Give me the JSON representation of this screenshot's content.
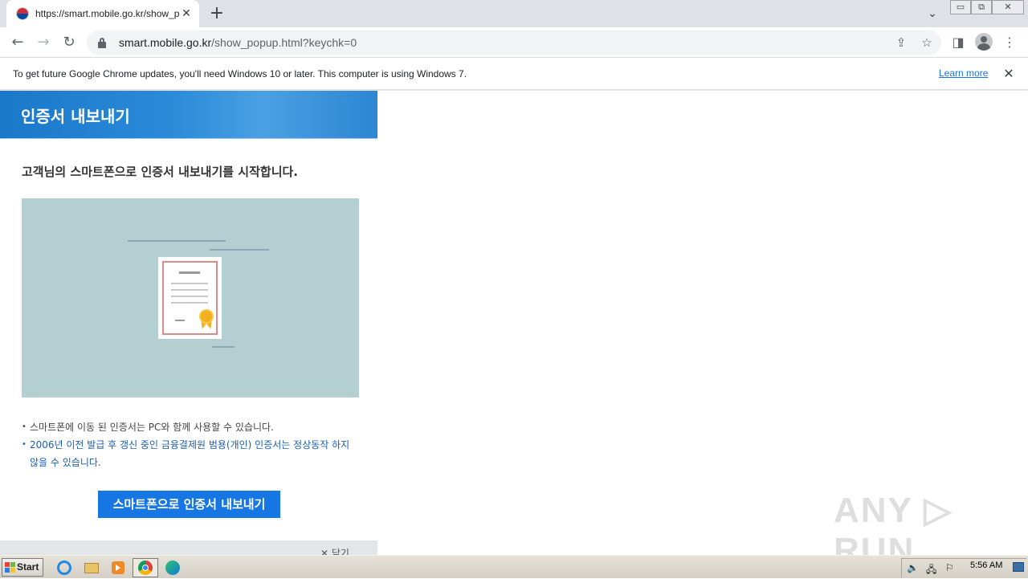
{
  "browser": {
    "tab": {
      "title": "https://smart.mobile.go.kr/show_po",
      "close": "✕"
    },
    "new_tab": "+",
    "tab_search": "⌄",
    "window_controls": {
      "minimize": "▭",
      "restore": "⧉",
      "close": "✕"
    },
    "nav": {
      "back": "←",
      "forward": "→",
      "reload": "↻"
    },
    "url": {
      "host": "smart.mobile.go.kr",
      "path": "/show_popup.html?keychk=0"
    },
    "omnibox_icons": {
      "share": "⇪",
      "bookmark": "☆"
    },
    "side_panel": "◨",
    "menu": "⋮"
  },
  "infobar": {
    "message": "To get future Google Chrome updates, you'll need Windows 10 or later. This computer is using Windows 7.",
    "learn_more": "Learn more",
    "close": "✕"
  },
  "popup": {
    "title": "인증서 내보내기",
    "intro": "고객님의 스마트폰으로 인증서 내보내기를 시작합니다.",
    "notes": [
      "스마트폰에 이동 된 인증서는 PC와 함께 사용할 수 있습니다.",
      "2006년 이전 발급 후 갱신 중인 금융결제원 범용(개인) 인증서는 정상동작 하지 않을 수 있습니다."
    ],
    "export_button": "스마트폰으로 인증서 내보내기",
    "close_link": "✕ 닫기"
  },
  "watermark": "ANY ▷ RUN",
  "taskbar": {
    "start": "Start",
    "apps": [
      "ie-icon",
      "explorer-icon",
      "media-player-icon",
      "chrome-icon",
      "edge-icon"
    ],
    "clock": "5:56 AM"
  },
  "colors": {
    "banner_blue": "#2b8ad8",
    "button_blue": "#1676e4",
    "illustration_bg": "#b4cfd2",
    "note_blue": "#1b5fb0"
  }
}
